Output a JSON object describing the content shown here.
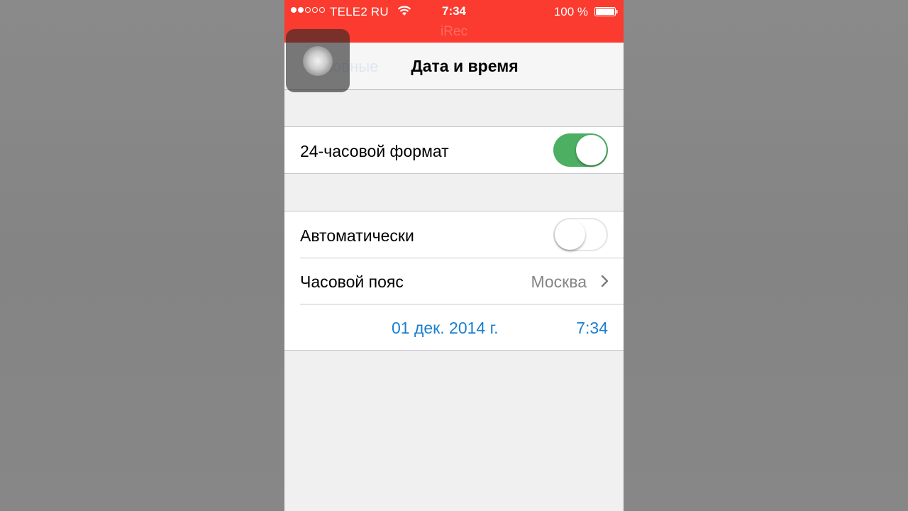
{
  "status_bar": {
    "carrier": "TELE2 RU",
    "time": "7:34",
    "battery_percent": "100 %",
    "signal_strength_dots_filled": 2,
    "recording_label": "iRec",
    "bar_color": "#fb3b2f"
  },
  "nav": {
    "back_label": "Основные",
    "title": "Дата и время"
  },
  "settings": {
    "hour24": {
      "label": "24-часовой формат",
      "enabled": true
    },
    "automatic": {
      "label": "Автоматически",
      "enabled": false
    },
    "timezone": {
      "label": "Часовой пояс",
      "value": "Москва"
    },
    "datetime": {
      "date": "01 дек. 2014 г.",
      "time": "7:34"
    }
  },
  "colors": {
    "accent_blue": "#1a7fd0",
    "toggle_on": "#4caf62"
  },
  "icons": [
    "signal-dots-icon",
    "wifi-icon",
    "battery-icon",
    "chevron-right-icon",
    "assistive-touch-icon"
  ]
}
